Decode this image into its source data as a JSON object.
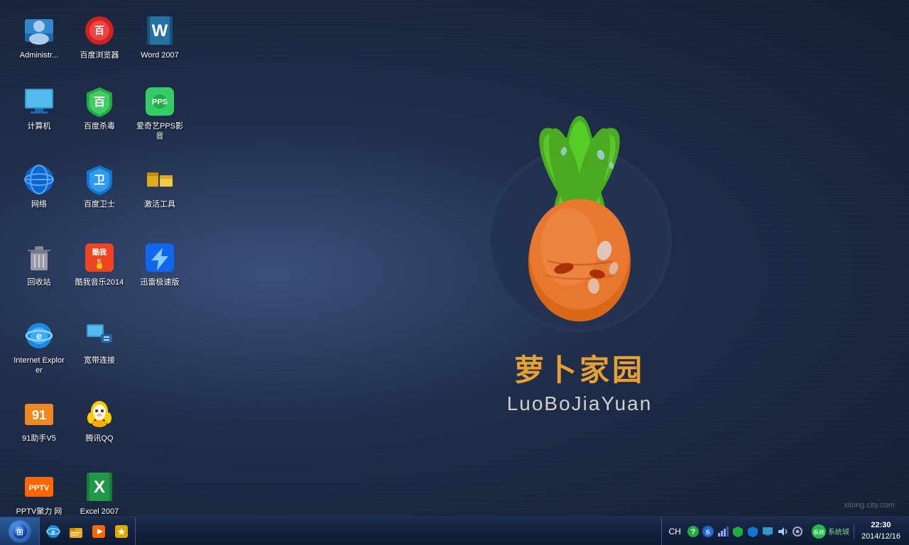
{
  "desktop": {
    "background_color": "#1e2d4a"
  },
  "wallpaper": {
    "logo_cn": "萝卜家园",
    "logo_en": "LuoBoJiaYuan"
  },
  "desktop_icons": [
    {
      "id": "administrator",
      "label": "Administr...",
      "icon_type": "user",
      "color": "#4488cc",
      "row": 0,
      "col": 0
    },
    {
      "id": "baidu-browser",
      "label": "百度浏览器",
      "icon_type": "browser",
      "color": "#cc3333",
      "row": 0,
      "col": 1
    },
    {
      "id": "word-2007",
      "label": "Word 2007",
      "icon_type": "word",
      "color": "#1a5276",
      "row": 0,
      "col": 2
    },
    {
      "id": "computer",
      "label": "计算机",
      "icon_type": "computer",
      "color": "#3399cc",
      "row": 1,
      "col": 0
    },
    {
      "id": "baidu-antivirus",
      "label": "百度杀毒",
      "icon_type": "shield",
      "color": "#22aa44",
      "row": 1,
      "col": 1
    },
    {
      "id": "aiqiyi-pps",
      "label": "爱奇艺PPS影音",
      "icon_type": "media",
      "color": "#33cc66",
      "row": 1,
      "col": 2
    },
    {
      "id": "network",
      "label": "网络",
      "icon_type": "network",
      "color": "#3399ff",
      "row": 2,
      "col": 0
    },
    {
      "id": "baidu-guard",
      "label": "百度卫士",
      "icon_type": "shield-blue",
      "color": "#1177cc",
      "row": 2,
      "col": 1
    },
    {
      "id": "activate-tool",
      "label": "激活工具",
      "icon_type": "folder",
      "color": "#ddaa22",
      "row": 2,
      "col": 2
    },
    {
      "id": "recycle-bin",
      "label": "回收站",
      "icon_type": "trash",
      "color": "#aaaaaa",
      "row": 3,
      "col": 0
    },
    {
      "id": "kuwo-music",
      "label": "酷我音乐2014",
      "icon_type": "music",
      "color": "#ee4422",
      "row": 3,
      "col": 1
    },
    {
      "id": "xunlei",
      "label": "迅雷极速版",
      "icon_type": "thunder",
      "color": "#2288ff",
      "row": 3,
      "col": 2
    },
    {
      "id": "ie",
      "label": "Internet Explorer",
      "icon_type": "ie",
      "color": "#1a88dd",
      "row": 4,
      "col": 0
    },
    {
      "id": "broadband",
      "label": "宽带连接",
      "icon_type": "network-conn",
      "color": "#2266cc",
      "row": 4,
      "col": 1
    },
    {
      "id": "91-assistant",
      "label": "91助手V5",
      "icon_type": "app",
      "color": "#ee8822",
      "row": 5,
      "col": 0
    },
    {
      "id": "tencent-qq",
      "label": "腾讯QQ",
      "icon_type": "qq",
      "color": "#ffcc00",
      "row": 5,
      "col": 1
    },
    {
      "id": "pptv",
      "label": "PPTV聚力 网络电视",
      "icon_type": "tv",
      "color": "#ff6600",
      "row": 6,
      "col": 0
    },
    {
      "id": "excel-2007",
      "label": "Excel 2007",
      "icon_type": "excel",
      "color": "#1a7a3a",
      "row": 6,
      "col": 1
    }
  ],
  "taskbar": {
    "start_label": "开始",
    "clock_time": "22:30",
    "clock_date": "2014/12/16",
    "lang": "CH",
    "system_label": "系统城",
    "watermark": "xitong.city.com"
  }
}
